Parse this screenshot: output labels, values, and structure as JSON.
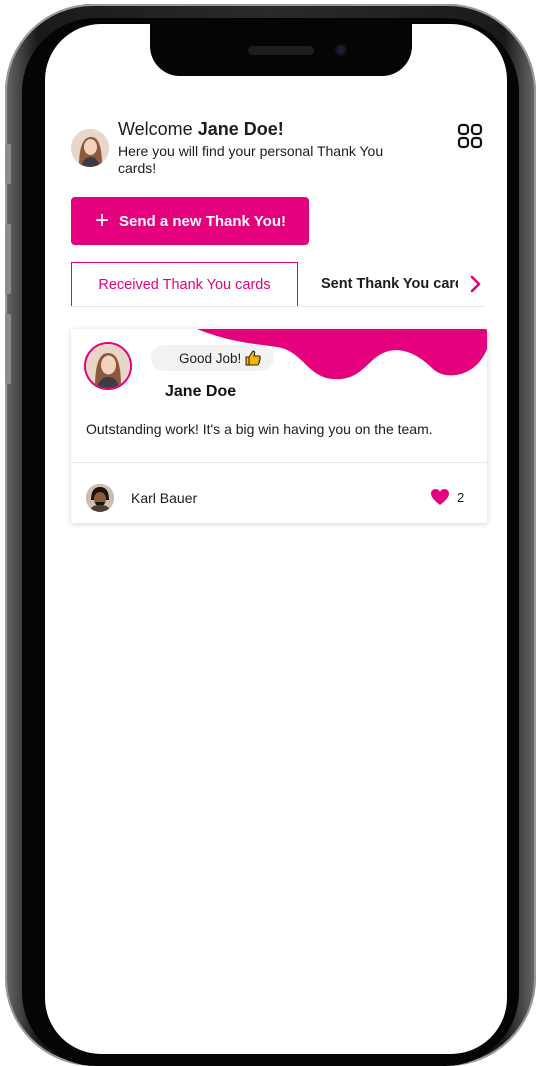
{
  "header": {
    "welcome_prefix": "Welcome",
    "user_name": "Jane Doe!",
    "subtitle": "Here you will find your personal Thank You cards!"
  },
  "actions": {
    "send_label": "Send a new Thank You!"
  },
  "tabs": [
    {
      "label": "Received Thank You cards",
      "active": true
    },
    {
      "label": "Sent Thank You cards",
      "active": false
    }
  ],
  "card": {
    "badge": "Good Job!",
    "recipient": "Jane Doe",
    "message": "Outstanding work! It's a big win having you on the team.",
    "sender": "Karl Bauer",
    "likes": "2"
  },
  "icons": {
    "grid": "grid-icon",
    "plus": "plus-icon",
    "chevron": "chevron-right-icon",
    "thumbs": "thumbs-up-icon",
    "heart": "heart-icon"
  },
  "colors": {
    "accent": "#e5007d",
    "text": "#1c1c1c",
    "badge_bg": "#f2f2f2"
  }
}
